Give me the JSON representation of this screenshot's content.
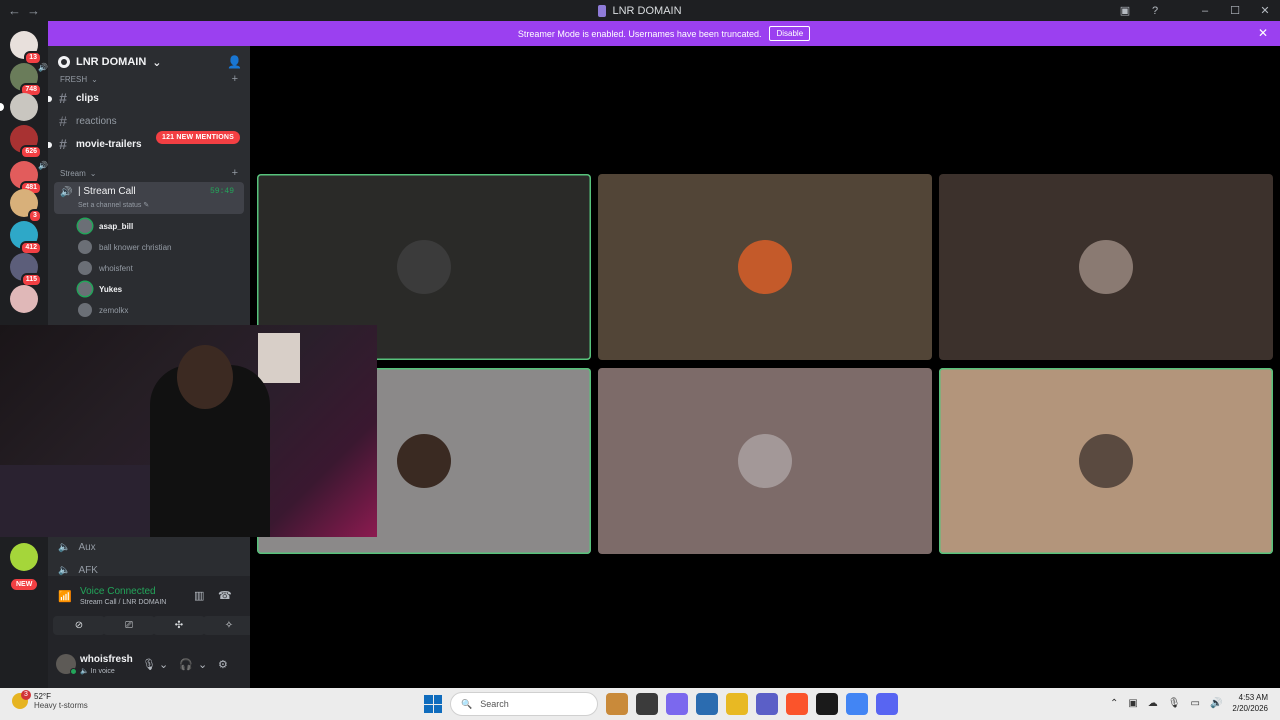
{
  "window": {
    "title": "LNR DOMAIN"
  },
  "banner": {
    "text": "Streamer Mode is enabled. Usernames have been truncated.",
    "button": "Disable"
  },
  "servers": [
    {
      "badge": "13",
      "color": "#e8e0dc"
    },
    {
      "badge": "748",
      "color": "#6a7c5a"
    },
    {
      "badge": "",
      "color": "#c9c6c0"
    },
    {
      "badge": "626",
      "color": "#a83232"
    },
    {
      "badge": "481",
      "color": "#e25c5c"
    },
    {
      "badge": "3",
      "color": "#d8b07a"
    },
    {
      "badge": "412",
      "color": "#2ea8c8"
    },
    {
      "badge": "115",
      "color": "#5c5e7a"
    },
    {
      "badge": "",
      "color": "#e0b8b8"
    }
  ],
  "new_badge": "NEW",
  "server": {
    "name": "LNR DOMAIN"
  },
  "categories": {
    "fresh": "FRESH",
    "stream": "Stream"
  },
  "channels": {
    "clips": "clips",
    "reactions": "reactions",
    "movie_trailers": "movie-trailers",
    "mentions": "121 NEW MENTIONS"
  },
  "voice_channel": {
    "name": "| Stream Call",
    "time": "59:49",
    "status": "Set a channel status"
  },
  "voice_users": [
    "asap_bill",
    "ball knower christian",
    "whoisfent",
    "Yukes",
    "zemolkx"
  ],
  "voice_channels": {
    "aux": "Aux",
    "afk": "AFK"
  },
  "voice_panel": {
    "title": "Voice Connected",
    "subtitle": "Stream Call / LNR DOMAIN"
  },
  "user": {
    "name": "whoisfresh",
    "status": "In voice"
  },
  "tiles": [
    {
      "bg": "#2a2a28",
      "speaking": true,
      "avatar": "#3b3b3b"
    },
    {
      "bg": "#524537",
      "speaking": false,
      "avatar": "#c45a2a"
    },
    {
      "bg": "#3c312c",
      "speaking": false,
      "avatar": "#8a7a72"
    },
    {
      "bg": "#8b8989",
      "speaking": true,
      "avatar": "#3a2a22"
    },
    {
      "bg": "#7d6b69",
      "speaking": false,
      "avatar": "#a39898"
    },
    {
      "bg": "#b3957b",
      "speaking": true,
      "avatar": "#5a4a40"
    }
  ],
  "taskbar": {
    "weather_badge": "3",
    "temp": "52°F",
    "weather": "Heavy t-storms",
    "search": "Search",
    "time": "4:53 AM",
    "date": "2/20/2026"
  }
}
